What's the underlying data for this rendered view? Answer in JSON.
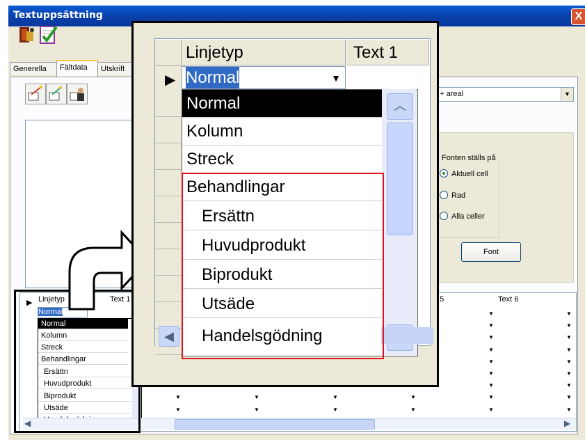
{
  "window": {
    "title": "Textuppsättning",
    "close_glyph": "X"
  },
  "toolbar": {
    "icons": [
      "exit-icon",
      "check-icon"
    ]
  },
  "tabs": [
    {
      "label": "Generella"
    },
    {
      "label": "Fältdata"
    },
    {
      "label": "Utskrift"
    }
  ],
  "active_tab": "Fältdata",
  "panel_tools": {
    "icons": [
      "tool-a-icon",
      "tool-b-icon",
      "tool-c-icon"
    ]
  },
  "area_combo": {
    "value": "a + areal"
  },
  "font_group": {
    "legend": "Fonten ställs på",
    "options": [
      {
        "label": "Aktuell cell",
        "checked": true
      },
      {
        "label": "Rad",
        "checked": false
      },
      {
        "label": "Alla celler",
        "checked": false
      }
    ],
    "button_label": "Font"
  },
  "zoom": {
    "col_linjetyp": "Linjetyp",
    "col_text1": "Text 1",
    "current_value": "Normal",
    "items": [
      "Normal",
      "Kolumn",
      "Streck",
      "Behandlingar",
      "Ersättn",
      "Huvudprodukt",
      "Biprodukt",
      "Utsäde",
      "Handelsgödning"
    ]
  },
  "grid": {
    "columns": [
      "Linjetyp",
      "Text 1",
      "t 5",
      "Text 6"
    ],
    "current_value": "Normal",
    "items": [
      "Normal",
      "Kolumn",
      "Streck",
      "Behandlingar",
      "Ersättn",
      "Huvudprodukt",
      "Biprodukt",
      "Utsäde",
      "Handelsgödning"
    ]
  }
}
